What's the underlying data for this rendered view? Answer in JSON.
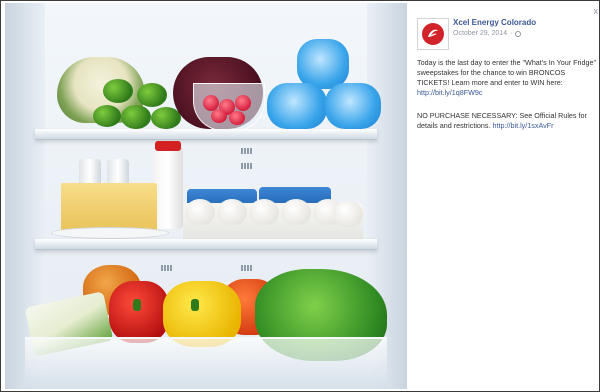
{
  "post": {
    "page_name": "Xcel Energy Colorado",
    "date": "October 29, 2014",
    "separator": "·",
    "paragraph1": "Today is the last day to enter the \"What's In Your Fridge\" sweepstakes for the chance to win BRONCOS TICKETS! Learn more and enter to WIN here:",
    "link1": "http://bit.ly/1q8FW9c",
    "paragraph2": "NO PURCHASE NECESSARY: See Official Rules for details and restrictions.",
    "link2": "http://bit.ly/1sxAvFr",
    "close_label": "x"
  },
  "icons": {
    "logo": "xcel-energy-logo",
    "privacy": "globe-icon",
    "close": "close-icon"
  },
  "colors": {
    "link": "#3b5998",
    "meta": "#9197a3",
    "logo_red": "#d2232a"
  }
}
